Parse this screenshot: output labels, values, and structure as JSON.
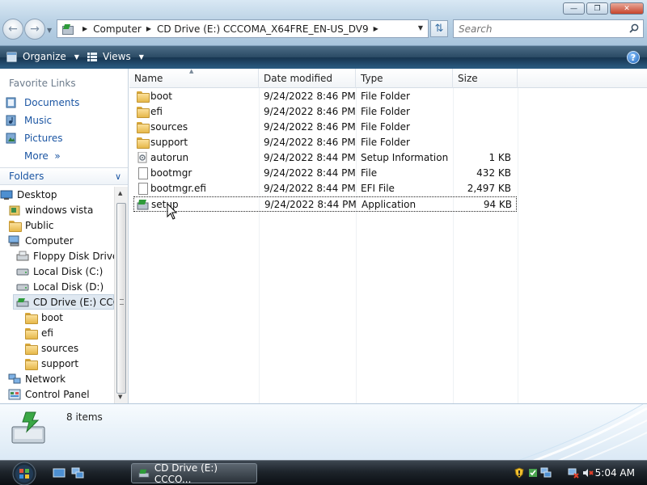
{
  "window": {
    "address": {
      "crumbs": [
        "Computer",
        "CD Drive (E:) CCCOMA_X64FRE_EN-US_DV9"
      ]
    },
    "search": {
      "placeholder": "Search"
    }
  },
  "toolbar": {
    "organize_label": "Organize",
    "views_label": "Views",
    "help_label": "?"
  },
  "navigation": {
    "favorites_header": "Favorite Links",
    "favorites": [
      {
        "label": "Documents",
        "icon": "documents-icon"
      },
      {
        "label": "Music",
        "icon": "music-icon"
      },
      {
        "label": "Pictures",
        "icon": "pictures-icon"
      }
    ],
    "more_label": "More",
    "folders_label": "Folders",
    "tree": [
      {
        "label": "Desktop",
        "icon": "desktop-icon"
      },
      {
        "label": "windows vista",
        "icon": "user-folder-icon"
      },
      {
        "label": "Public",
        "icon": "folder-icon"
      },
      {
        "label": "Computer",
        "icon": "computer-icon"
      },
      {
        "label": "Floppy Disk Drive (",
        "icon": "floppy-drive-icon"
      },
      {
        "label": "Local Disk (C:)",
        "icon": "hard-disk-icon"
      },
      {
        "label": "Local Disk (D:)",
        "icon": "hard-disk-icon"
      },
      {
        "label": "CD Drive (E:) CCCO",
        "icon": "cd-drive-icon",
        "selected": true
      },
      {
        "label": "boot",
        "icon": "folder-icon"
      },
      {
        "label": "efi",
        "icon": "folder-icon"
      },
      {
        "label": "sources",
        "icon": "folder-icon"
      },
      {
        "label": "support",
        "icon": "folder-icon"
      },
      {
        "label": "Network",
        "icon": "network-icon"
      },
      {
        "label": "Control Panel",
        "icon": "control-panel-icon"
      }
    ]
  },
  "file_list": {
    "columns": [
      "Name",
      "Date modified",
      "Type",
      "Size"
    ],
    "rows": [
      {
        "name": "boot",
        "date": "9/24/2022 8:46 PM",
        "type": "File Folder",
        "size": "",
        "icon": "folder-icon"
      },
      {
        "name": "efi",
        "date": "9/24/2022 8:46 PM",
        "type": "File Folder",
        "size": "",
        "icon": "folder-icon"
      },
      {
        "name": "sources",
        "date": "9/24/2022 8:46 PM",
        "type": "File Folder",
        "size": "",
        "icon": "folder-icon"
      },
      {
        "name": "support",
        "date": "9/24/2022 8:46 PM",
        "type": "File Folder",
        "size": "",
        "icon": "folder-icon"
      },
      {
        "name": "autorun",
        "date": "9/24/2022 8:44 PM",
        "type": "Setup Information",
        "size": "1 KB",
        "icon": "setup-info-icon"
      },
      {
        "name": "bootmgr",
        "date": "9/24/2022 8:44 PM",
        "type": "File",
        "size": "432 KB",
        "icon": "file-icon"
      },
      {
        "name": "bootmgr.efi",
        "date": "9/24/2022 8:44 PM",
        "type": "EFI File",
        "size": "2,497 KB",
        "icon": "file-icon"
      },
      {
        "name": "setup",
        "date": "9/24/2022 8:44 PM",
        "type": "Application",
        "size": "94 KB",
        "icon": "setup-app-icon",
        "focused": true
      }
    ]
  },
  "details": {
    "item_count": "8 items"
  },
  "taskbar": {
    "window_button_label": "CD Drive (E:) CCCO...",
    "clock": "5:04 AM"
  },
  "colors": {
    "link_blue": "#1c56a3",
    "cmdbar_dark": "#173550",
    "taskbar_dark": "#0b0f13"
  }
}
